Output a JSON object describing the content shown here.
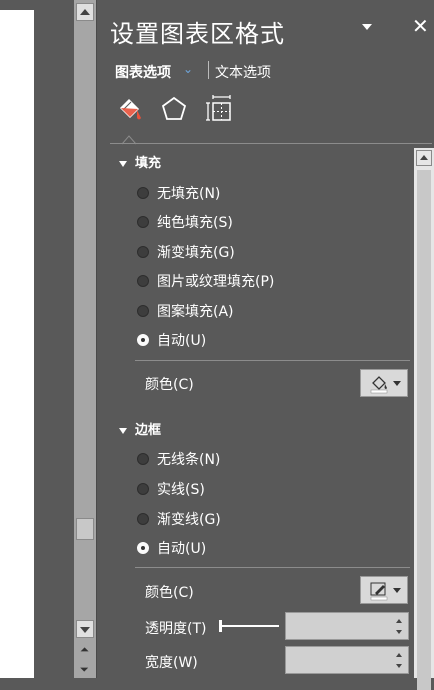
{
  "pane": {
    "title": "设置图表区格式",
    "close": "✕",
    "tabs": [
      {
        "label": "图表选项",
        "chevron": "⌄"
      },
      {
        "label": "文本选项"
      }
    ],
    "icons": [
      "fill-bucket-icon",
      "pentagon-icon",
      "size-properties-icon"
    ]
  },
  "fill": {
    "heading": "填充",
    "options": [
      {
        "label": "无填充(N)",
        "selected": false
      },
      {
        "label": "纯色填充(S)",
        "selected": false
      },
      {
        "label": "渐变填充(G)",
        "selected": false
      },
      {
        "label": "图片或纹理填充(P)",
        "selected": false
      },
      {
        "label": "图案填充(A)",
        "selected": false
      },
      {
        "label": "自动(U)",
        "selected": true
      }
    ],
    "color_label": "颜色(C)"
  },
  "border": {
    "heading": "边框",
    "options": [
      {
        "label": "无线条(N)",
        "selected": false
      },
      {
        "label": "实线(S)",
        "selected": false
      },
      {
        "label": "渐变线(G)",
        "selected": false
      },
      {
        "label": "自动(U)",
        "selected": true
      }
    ],
    "color_label": "颜色(C)",
    "transparency_label": "透明度(T)",
    "width_label": "宽度(W)"
  },
  "colors": {
    "pane_bg": "#595959",
    "accent": "#6ea6dc",
    "fill_icon_accent": "#e8513a"
  }
}
